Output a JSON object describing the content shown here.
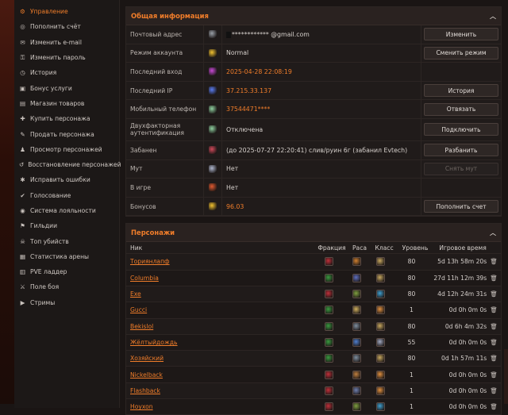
{
  "sidebar": {
    "items": [
      {
        "label": "Управление",
        "icon": "gear-icon",
        "glyph": "⚙",
        "active": true
      },
      {
        "label": "Пополнить счёт",
        "icon": "coins-icon",
        "glyph": "◎"
      },
      {
        "label": "Изменить e-mail",
        "icon": "envelope-icon",
        "glyph": "✉"
      },
      {
        "label": "Изменить пароль",
        "icon": "key-icon",
        "glyph": "⚿"
      },
      {
        "label": "История",
        "icon": "clock-icon",
        "glyph": "◷"
      },
      {
        "label": "Бонус услуги",
        "icon": "gift-icon",
        "glyph": "▣"
      },
      {
        "label": "Магазин товаров",
        "icon": "cart-icon",
        "glyph": "▤"
      },
      {
        "label": "Купить персонажа",
        "icon": "buy-character-icon",
        "glyph": "✚"
      },
      {
        "label": "Продать персонажа",
        "icon": "sell-character-icon",
        "glyph": "✎"
      },
      {
        "label": "Просмотр персонажей",
        "icon": "character-icon",
        "glyph": "♟"
      },
      {
        "label": "Восстановление персонажей",
        "icon": "restore-icon",
        "glyph": "↺"
      },
      {
        "label": "Исправить ошибки",
        "icon": "bug-icon",
        "glyph": "✱"
      },
      {
        "label": "Голосование",
        "icon": "vote-icon",
        "glyph": "✔"
      },
      {
        "label": "Система лояльности",
        "icon": "loyalty-icon",
        "glyph": "◉"
      },
      {
        "label": "Гильдии",
        "icon": "guild-icon",
        "glyph": "⚑"
      },
      {
        "label": "Топ убийств",
        "icon": "skull-icon",
        "glyph": "☠"
      },
      {
        "label": "Статистика арены",
        "icon": "chart-icon",
        "glyph": "▦"
      },
      {
        "label": "PVE ладдер",
        "icon": "ladder-icon",
        "glyph": "▥"
      },
      {
        "label": "Поле боя",
        "icon": "battlefield-icon",
        "glyph": "⚔"
      },
      {
        "label": "Стримы",
        "icon": "stream-icon",
        "glyph": "▶"
      }
    ]
  },
  "info": {
    "title": "Общая информация",
    "rows": [
      {
        "label": "Почтовый адрес",
        "icon": "mail-icon",
        "icon_color": "#9aa0a8",
        "value": "************ @gmail.com",
        "masked_prefix": "▇",
        "orange": false,
        "button": "Изменить",
        "disabled": false
      },
      {
        "label": "Режим аккаунта",
        "icon": "star-icon",
        "icon_color": "#f2c230",
        "value": "Normal",
        "orange": false,
        "button": "Сменить режим",
        "disabled": false
      },
      {
        "label": "Последний вход",
        "icon": "login-icon",
        "icon_color": "#c84ad6",
        "value": "2025-04-28 22:08:19",
        "orange": true,
        "button": "",
        "disabled": false
      },
      {
        "label": "Последний IP",
        "icon": "network-icon",
        "icon_color": "#5a7cf0",
        "value": "37.215.33.137",
        "orange": true,
        "button": "История",
        "disabled": false
      },
      {
        "label": "Мобильный телефон",
        "icon": "phone-icon",
        "icon_color": "#8fd0a0",
        "value": "37544471****",
        "orange": true,
        "button": "Отвязать",
        "disabled": false
      },
      {
        "label": "Двухфакторная аутентификация",
        "icon": "twofa-icon",
        "icon_color": "#8fd0a0",
        "value": "Отключена",
        "orange": false,
        "button": "Подключить",
        "disabled": false
      },
      {
        "label": "Забанен",
        "icon": "ban-icon",
        "icon_color": "#d04a5a",
        "value": "(до 2025-07-27 22:20:41) слив/руин 6г (забанил Evtech)",
        "orange": false,
        "button": "Разбанить",
        "disabled": false
      },
      {
        "label": "Мут",
        "icon": "mute-icon",
        "icon_color": "#b0b8d0",
        "value": "Нет",
        "orange": false,
        "button": "Снять мут",
        "disabled": true
      },
      {
        "label": "В игре",
        "icon": "ingame-icon",
        "icon_color": "#e05a30",
        "value": "Нет",
        "orange": false,
        "button": "",
        "disabled": false
      },
      {
        "label": "Бонусов",
        "icon": "coin-icon",
        "icon_color": "#f2c230",
        "value": "96.03",
        "orange": true,
        "button": "Пополнить счет",
        "disabled": false
      }
    ]
  },
  "characters": {
    "title": "Персонажи",
    "headers": {
      "nick": "Ник",
      "faction": "Фракция",
      "race": "Раса",
      "class": "Класс",
      "level": "Уровень",
      "playtime": "Игровое время"
    },
    "rows": [
      {
        "nick": "Ториянлапф",
        "faction_color": "#c0303a",
        "race_color": "#d08030",
        "class_color": "#c8a860",
        "level": "80",
        "time": "5d 13h 58m 20s"
      },
      {
        "nick": "Columbia",
        "faction_color": "#3a9a40",
        "race_color": "#6070c0",
        "class_color": "#c8a860",
        "level": "80",
        "time": "27d 11h 12m 39s"
      },
      {
        "nick": "Exe",
        "faction_color": "#c0303a",
        "race_color": "#80a040",
        "class_color": "#40a0d0",
        "level": "80",
        "time": "4d 12h 24m 31s"
      },
      {
        "nick": "Gucci",
        "faction_color": "#3a9a40",
        "race_color": "#d0b060",
        "class_color": "#e09040",
        "level": "1",
        "time": "0d 0h 0m 0s"
      },
      {
        "nick": "Bekislol",
        "faction_color": "#3a9a40",
        "race_color": "#8090a0",
        "class_color": "#c8a860",
        "level": "80",
        "time": "0d 6h 4m 32s"
      },
      {
        "nick": "Жёлтыйдождь",
        "faction_color": "#3a9a40",
        "race_color": "#5080d0",
        "class_color": "#a0a8c0",
        "level": "55",
        "time": "0d 0h 0m 0s"
      },
      {
        "nick": "Хозяйский",
        "faction_color": "#3a9a40",
        "race_color": "#8090a0",
        "class_color": "#c8a860",
        "level": "80",
        "time": "0d 1h 57m 11s"
      },
      {
        "nick": "Nickelback",
        "faction_color": "#c0303a",
        "race_color": "#c08040",
        "class_color": "#e09040",
        "level": "1",
        "time": "0d 0h 0m 0s"
      },
      {
        "nick": "Flashback",
        "faction_color": "#c0303a",
        "race_color": "#7080b0",
        "class_color": "#e09040",
        "level": "1",
        "time": "0d 0h 0m 0s"
      },
      {
        "nick": "Hoyxon",
        "faction_color": "#c0303a",
        "race_color": "#80a040",
        "class_color": "#40a0d0",
        "level": "1",
        "time": "0d 0h 0m 0s"
      }
    ]
  }
}
